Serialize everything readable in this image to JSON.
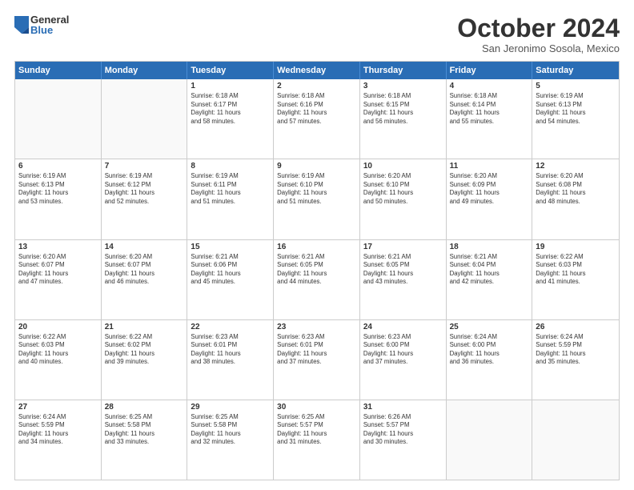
{
  "logo": {
    "general": "General",
    "blue": "Blue"
  },
  "header": {
    "month": "October 2024",
    "location": "San Jeronimo Sosola, Mexico"
  },
  "days": [
    "Sunday",
    "Monday",
    "Tuesday",
    "Wednesday",
    "Thursday",
    "Friday",
    "Saturday"
  ],
  "rows": [
    [
      {
        "day": "",
        "lines": []
      },
      {
        "day": "",
        "lines": []
      },
      {
        "day": "1",
        "lines": [
          "Sunrise: 6:18 AM",
          "Sunset: 6:17 PM",
          "Daylight: 11 hours",
          "and 58 minutes."
        ]
      },
      {
        "day": "2",
        "lines": [
          "Sunrise: 6:18 AM",
          "Sunset: 6:16 PM",
          "Daylight: 11 hours",
          "and 57 minutes."
        ]
      },
      {
        "day": "3",
        "lines": [
          "Sunrise: 6:18 AM",
          "Sunset: 6:15 PM",
          "Daylight: 11 hours",
          "and 56 minutes."
        ]
      },
      {
        "day": "4",
        "lines": [
          "Sunrise: 6:18 AM",
          "Sunset: 6:14 PM",
          "Daylight: 11 hours",
          "and 55 minutes."
        ]
      },
      {
        "day": "5",
        "lines": [
          "Sunrise: 6:19 AM",
          "Sunset: 6:13 PM",
          "Daylight: 11 hours",
          "and 54 minutes."
        ]
      }
    ],
    [
      {
        "day": "6",
        "lines": [
          "Sunrise: 6:19 AM",
          "Sunset: 6:13 PM",
          "Daylight: 11 hours",
          "and 53 minutes."
        ]
      },
      {
        "day": "7",
        "lines": [
          "Sunrise: 6:19 AM",
          "Sunset: 6:12 PM",
          "Daylight: 11 hours",
          "and 52 minutes."
        ]
      },
      {
        "day": "8",
        "lines": [
          "Sunrise: 6:19 AM",
          "Sunset: 6:11 PM",
          "Daylight: 11 hours",
          "and 51 minutes."
        ]
      },
      {
        "day": "9",
        "lines": [
          "Sunrise: 6:19 AM",
          "Sunset: 6:10 PM",
          "Daylight: 11 hours",
          "and 51 minutes."
        ]
      },
      {
        "day": "10",
        "lines": [
          "Sunrise: 6:20 AM",
          "Sunset: 6:10 PM",
          "Daylight: 11 hours",
          "and 50 minutes."
        ]
      },
      {
        "day": "11",
        "lines": [
          "Sunrise: 6:20 AM",
          "Sunset: 6:09 PM",
          "Daylight: 11 hours",
          "and 49 minutes."
        ]
      },
      {
        "day": "12",
        "lines": [
          "Sunrise: 6:20 AM",
          "Sunset: 6:08 PM",
          "Daylight: 11 hours",
          "and 48 minutes."
        ]
      }
    ],
    [
      {
        "day": "13",
        "lines": [
          "Sunrise: 6:20 AM",
          "Sunset: 6:07 PM",
          "Daylight: 11 hours",
          "and 47 minutes."
        ]
      },
      {
        "day": "14",
        "lines": [
          "Sunrise: 6:20 AM",
          "Sunset: 6:07 PM",
          "Daylight: 11 hours",
          "and 46 minutes."
        ]
      },
      {
        "day": "15",
        "lines": [
          "Sunrise: 6:21 AM",
          "Sunset: 6:06 PM",
          "Daylight: 11 hours",
          "and 45 minutes."
        ]
      },
      {
        "day": "16",
        "lines": [
          "Sunrise: 6:21 AM",
          "Sunset: 6:05 PM",
          "Daylight: 11 hours",
          "and 44 minutes."
        ]
      },
      {
        "day": "17",
        "lines": [
          "Sunrise: 6:21 AM",
          "Sunset: 6:05 PM",
          "Daylight: 11 hours",
          "and 43 minutes."
        ]
      },
      {
        "day": "18",
        "lines": [
          "Sunrise: 6:21 AM",
          "Sunset: 6:04 PM",
          "Daylight: 11 hours",
          "and 42 minutes."
        ]
      },
      {
        "day": "19",
        "lines": [
          "Sunrise: 6:22 AM",
          "Sunset: 6:03 PM",
          "Daylight: 11 hours",
          "and 41 minutes."
        ]
      }
    ],
    [
      {
        "day": "20",
        "lines": [
          "Sunrise: 6:22 AM",
          "Sunset: 6:03 PM",
          "Daylight: 11 hours",
          "and 40 minutes."
        ]
      },
      {
        "day": "21",
        "lines": [
          "Sunrise: 6:22 AM",
          "Sunset: 6:02 PM",
          "Daylight: 11 hours",
          "and 39 minutes."
        ]
      },
      {
        "day": "22",
        "lines": [
          "Sunrise: 6:23 AM",
          "Sunset: 6:01 PM",
          "Daylight: 11 hours",
          "and 38 minutes."
        ]
      },
      {
        "day": "23",
        "lines": [
          "Sunrise: 6:23 AM",
          "Sunset: 6:01 PM",
          "Daylight: 11 hours",
          "and 37 minutes."
        ]
      },
      {
        "day": "24",
        "lines": [
          "Sunrise: 6:23 AM",
          "Sunset: 6:00 PM",
          "Daylight: 11 hours",
          "and 37 minutes."
        ]
      },
      {
        "day": "25",
        "lines": [
          "Sunrise: 6:24 AM",
          "Sunset: 6:00 PM",
          "Daylight: 11 hours",
          "and 36 minutes."
        ]
      },
      {
        "day": "26",
        "lines": [
          "Sunrise: 6:24 AM",
          "Sunset: 5:59 PM",
          "Daylight: 11 hours",
          "and 35 minutes."
        ]
      }
    ],
    [
      {
        "day": "27",
        "lines": [
          "Sunrise: 6:24 AM",
          "Sunset: 5:59 PM",
          "Daylight: 11 hours",
          "and 34 minutes."
        ]
      },
      {
        "day": "28",
        "lines": [
          "Sunrise: 6:25 AM",
          "Sunset: 5:58 PM",
          "Daylight: 11 hours",
          "and 33 minutes."
        ]
      },
      {
        "day": "29",
        "lines": [
          "Sunrise: 6:25 AM",
          "Sunset: 5:58 PM",
          "Daylight: 11 hours",
          "and 32 minutes."
        ]
      },
      {
        "day": "30",
        "lines": [
          "Sunrise: 6:25 AM",
          "Sunset: 5:57 PM",
          "Daylight: 11 hours",
          "and 31 minutes."
        ]
      },
      {
        "day": "31",
        "lines": [
          "Sunrise: 6:26 AM",
          "Sunset: 5:57 PM",
          "Daylight: 11 hours",
          "and 30 minutes."
        ]
      },
      {
        "day": "",
        "lines": []
      },
      {
        "day": "",
        "lines": []
      }
    ]
  ]
}
